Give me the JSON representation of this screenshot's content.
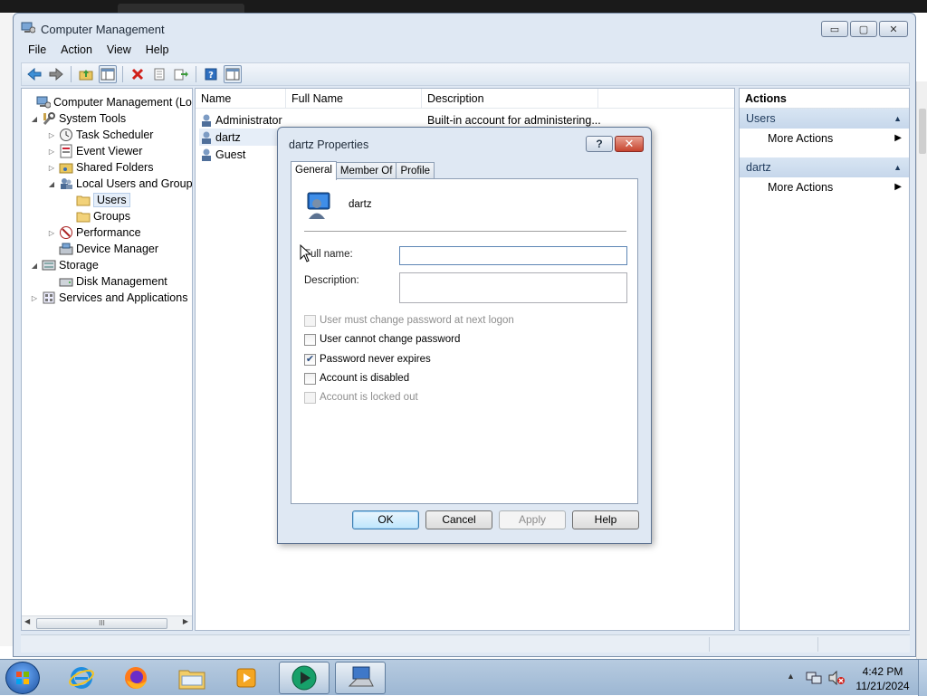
{
  "window": {
    "title": "Computer Management",
    "controls": {
      "minimize": "▭",
      "maximize": "▢",
      "close": "✕"
    }
  },
  "menu": [
    "File",
    "Action",
    "View",
    "Help"
  ],
  "tree": {
    "items": [
      {
        "label": "Computer Management (Local",
        "icon": "computer-management-icon"
      },
      {
        "label": "System Tools",
        "icon": "tools-icon"
      },
      {
        "label": "Task Scheduler",
        "icon": "clock-icon"
      },
      {
        "label": "Event Viewer",
        "icon": "event-viewer-icon"
      },
      {
        "label": "Shared Folders",
        "icon": "shared-folder-icon"
      },
      {
        "label": "Local Users and Groups",
        "icon": "users-groups-icon"
      },
      {
        "label": "Users",
        "icon": "folder-icon"
      },
      {
        "label": "Groups",
        "icon": "folder-icon"
      },
      {
        "label": "Performance",
        "icon": "performance-icon"
      },
      {
        "label": "Device Manager",
        "icon": "device-manager-icon"
      },
      {
        "label": "Storage",
        "icon": "storage-icon"
      },
      {
        "label": "Disk Management",
        "icon": "disk-icon"
      },
      {
        "label": "Services and Applications",
        "icon": "services-icon"
      }
    ],
    "scroll_thumb": "III"
  },
  "list": {
    "columns": [
      "Name",
      "Full Name",
      "Description"
    ],
    "rows": [
      {
        "name": "Administrator",
        "full_name": "",
        "description": "Built-in account for administering..."
      },
      {
        "name": "dartz",
        "full_name": "",
        "description": ""
      },
      {
        "name": "Guest",
        "full_name": "",
        "description": ""
      }
    ]
  },
  "actions": {
    "header": "Actions",
    "groups": [
      {
        "title": "Users",
        "item": "More Actions"
      },
      {
        "title": "dartz",
        "item": "More Actions"
      }
    ]
  },
  "dialog": {
    "title": "dartz Properties",
    "help": "?",
    "close": "✕",
    "tabs": [
      "General",
      "Member Of",
      "Profile"
    ],
    "active_tab": "General",
    "user_name": "dartz",
    "full_name_label": "Full name:",
    "full_name_value": "",
    "description_label": "Description:",
    "description_value": "",
    "checkboxes": [
      {
        "label": "User must change password at next logon",
        "checked": false,
        "enabled": false
      },
      {
        "label": "User cannot change password",
        "checked": false,
        "enabled": true
      },
      {
        "label": "Password never expires",
        "checked": true,
        "enabled": true
      },
      {
        "label": "Account is disabled",
        "checked": false,
        "enabled": true
      },
      {
        "label": "Account is locked out",
        "checked": false,
        "enabled": false
      }
    ],
    "buttons": {
      "ok": "OK",
      "cancel": "Cancel",
      "apply": "Apply",
      "help": "Help"
    }
  },
  "taskbar": {
    "clock_time": "4:42 PM",
    "clock_date": "11/21/2024"
  }
}
